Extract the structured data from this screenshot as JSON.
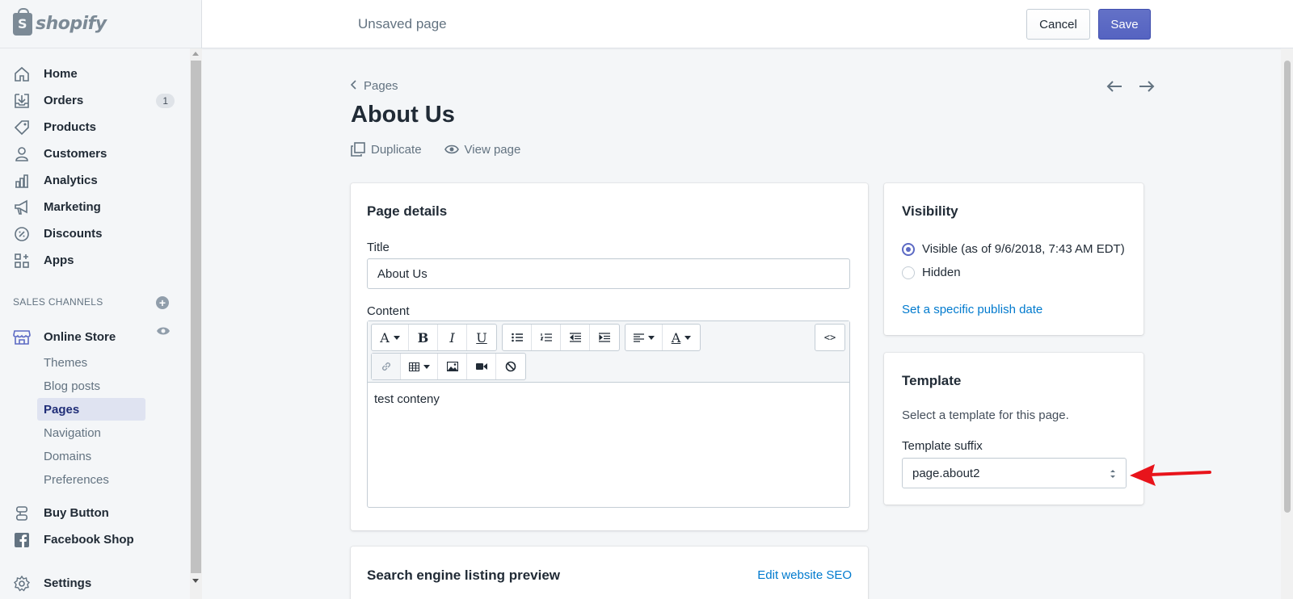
{
  "app": {
    "logo_text": "shopify",
    "brand_color": "#5c6ac4"
  },
  "topbar": {
    "title": "Unsaved page",
    "cancel_label": "Cancel",
    "save_label": "Save"
  },
  "sidebar": {
    "items": [
      {
        "label": "Home",
        "icon": "home-icon"
      },
      {
        "label": "Orders",
        "icon": "orders-icon",
        "badge": "1"
      },
      {
        "label": "Products",
        "icon": "tag-icon"
      },
      {
        "label": "Customers",
        "icon": "person-icon"
      },
      {
        "label": "Analytics",
        "icon": "bar-chart-icon"
      },
      {
        "label": "Marketing",
        "icon": "megaphone-icon"
      },
      {
        "label": "Discounts",
        "icon": "discount-icon"
      },
      {
        "label": "Apps",
        "icon": "apps-icon"
      }
    ],
    "sales_channels_heading": "SALES CHANNELS",
    "online_store": {
      "label": "Online Store",
      "icon": "store-icon"
    },
    "sub_items": [
      "Themes",
      "Blog posts",
      "Pages",
      "Navigation",
      "Domains",
      "Preferences"
    ],
    "active_sub_item": "Pages",
    "buy_button": {
      "label": "Buy Button",
      "icon": "buy-button-icon"
    },
    "facebook_shop": {
      "label": "Facebook Shop",
      "icon": "facebook-icon"
    },
    "settings": {
      "label": "Settings",
      "icon": "gear-icon"
    }
  },
  "main": {
    "breadcrumb": "Pages",
    "title": "About Us",
    "actions": {
      "duplicate": "Duplicate",
      "view_page": "View page"
    }
  },
  "page_details": {
    "heading": "Page details",
    "title_label": "Title",
    "title_value": "About Us",
    "content_label": "Content",
    "content_value": "test conteny",
    "toolbar": {
      "bold": "B",
      "italic": "I",
      "underline": "U",
      "font": "A",
      "color": "A",
      "source": "<>"
    }
  },
  "visibility": {
    "heading": "Visibility",
    "visible_label": "Visible (as of 9/6/2018, 7:43 AM EDT)",
    "hidden_label": "Hidden",
    "selected": "visible",
    "publish_link": "Set a specific publish date"
  },
  "template": {
    "heading": "Template",
    "description": "Select a template for this page.",
    "suffix_label": "Template suffix",
    "suffix_value": "page.about2"
  },
  "seo": {
    "heading": "Search engine listing preview",
    "edit_link": "Edit website SEO"
  },
  "colors": {
    "link": "#007ace",
    "annotation_arrow": "#e8141b"
  }
}
